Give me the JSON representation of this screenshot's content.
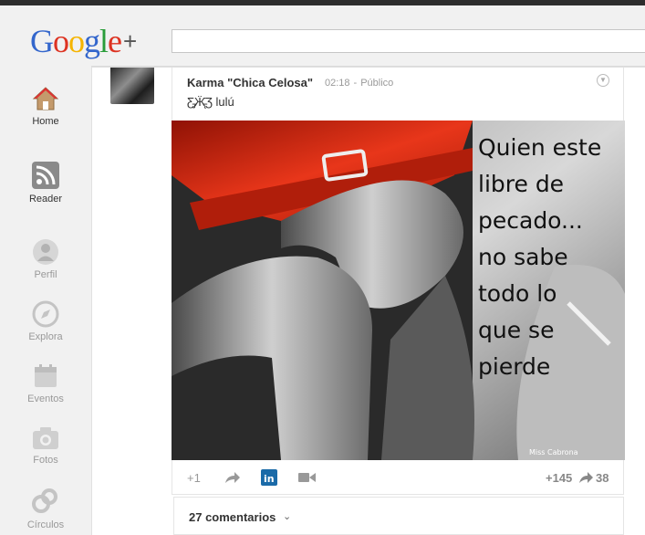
{
  "header": {
    "logo_letters": [
      "G",
      "o",
      "o",
      "g",
      "l",
      "e"
    ],
    "logo_plus": "+",
    "search_placeholder": ""
  },
  "sidebar": {
    "items": [
      {
        "label": "Home",
        "icon": "home-icon",
        "active": true
      },
      {
        "label": "Reader",
        "icon": "rss-icon",
        "active": true
      },
      {
        "label": "Perfil",
        "icon": "profile-icon",
        "active": false
      },
      {
        "label": "Explora",
        "icon": "compass-icon",
        "active": false
      },
      {
        "label": "Eventos",
        "icon": "calendar-icon",
        "active": false
      },
      {
        "label": "Fotos",
        "icon": "camera-icon",
        "active": false
      },
      {
        "label": "Círculos",
        "icon": "circles-icon",
        "active": false
      }
    ]
  },
  "post": {
    "author": "Karma \"Chica Celosa\"",
    "time": "02:18",
    "separator": "-",
    "visibility": "Público",
    "text": "Ƹ̵̡Ӝ̵̨̄Ʒ lulú",
    "image_caption_lines": [
      "Quien este",
      "libre de",
      "pecado...",
      "no sabe",
      "todo lo",
      "que se",
      "pierde"
    ],
    "image_signature": "Miss Cabrona",
    "plus_one": "+1",
    "plus_count": "+145",
    "share_count": "38"
  },
  "comments": {
    "label": "27 comentarios"
  },
  "colors": {
    "accent_blue": "#3366cc",
    "red_dress": "#d6260f",
    "linkedin": "#1a6aa8"
  }
}
